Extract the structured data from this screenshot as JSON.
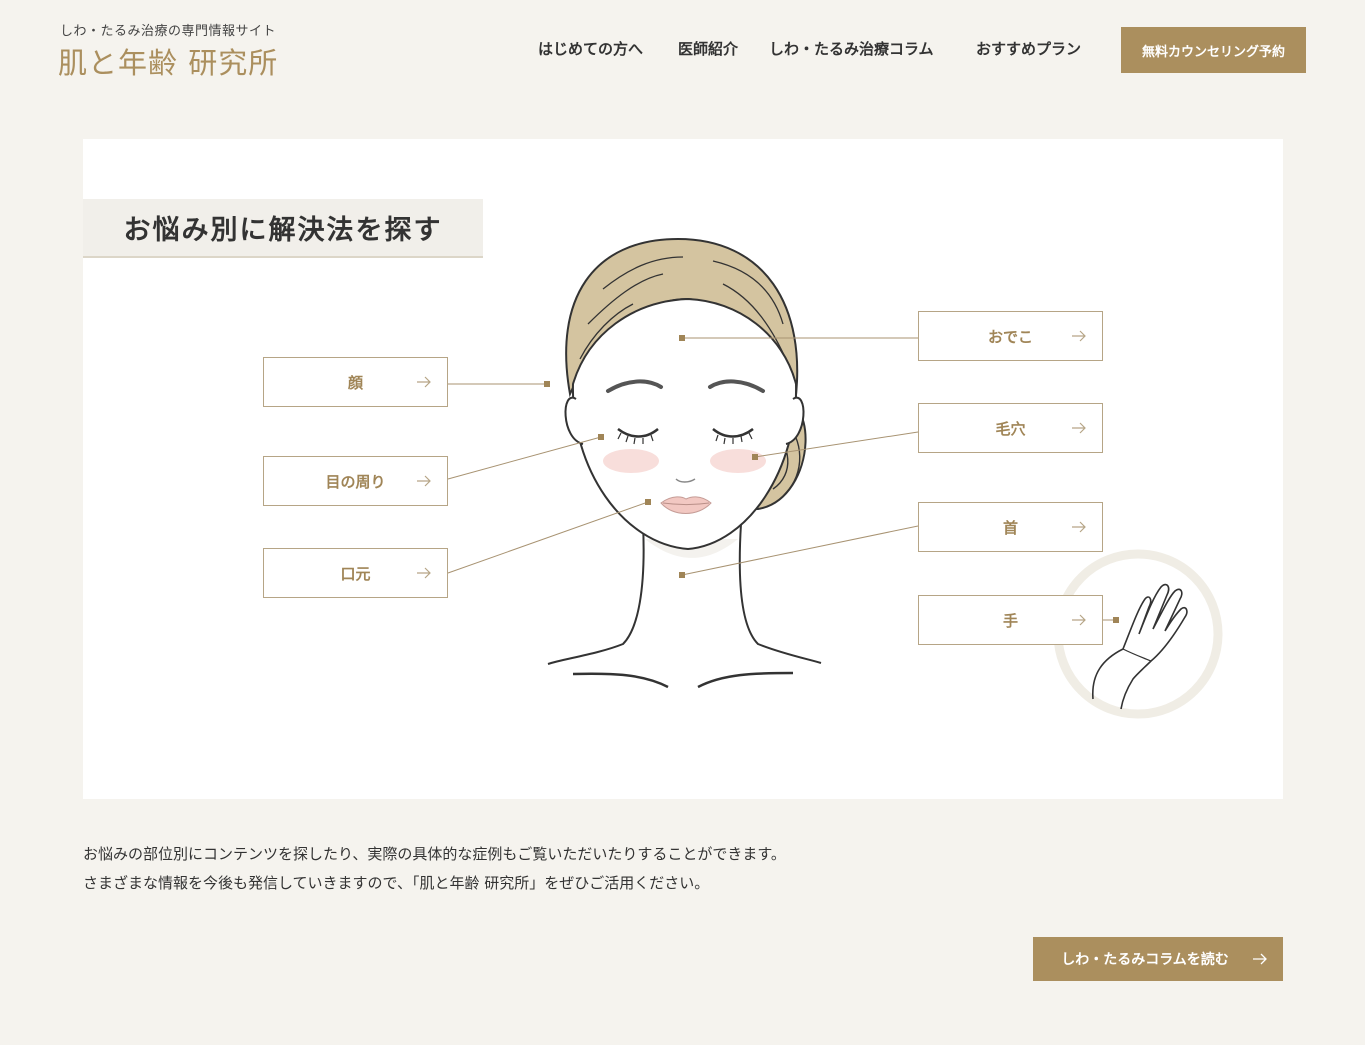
{
  "header": {
    "tagline": "しわ・たるみ治療の専門情報サイト",
    "logo": "肌と年齢 研究所",
    "nav": [
      "はじめての方へ",
      "医師紹介",
      "しわ・たるみ治療コラム",
      "おすすめプラン"
    ],
    "cta": "無料カウンセリング予約"
  },
  "section": {
    "title": "お悩み別に解決法を探す",
    "areas": {
      "face": "顔",
      "eyes": "目の周り",
      "mouth": "口元",
      "forehead": "おでこ",
      "pores": "毛穴",
      "neck": "首",
      "hand": "手"
    }
  },
  "intro": {
    "line1": "お悩みの部位別にコンテンツを探したり、実際の具体的な症例もご覧いただいたりすることができます。",
    "line2": "さまざまな情報を今後も発信していきますので、「肌と年齢 研究所」をぜひご活用ください。"
  },
  "read_button": "しわ・たるみコラムを読む",
  "colors": {
    "accent": "#ab8f5e",
    "background": "#f5f3ee",
    "hair": "#d4c4a0",
    "blush": "#f6d6d2"
  },
  "icons": [
    "arrow-right-icon",
    "face-illustration",
    "hand-illustration"
  ]
}
